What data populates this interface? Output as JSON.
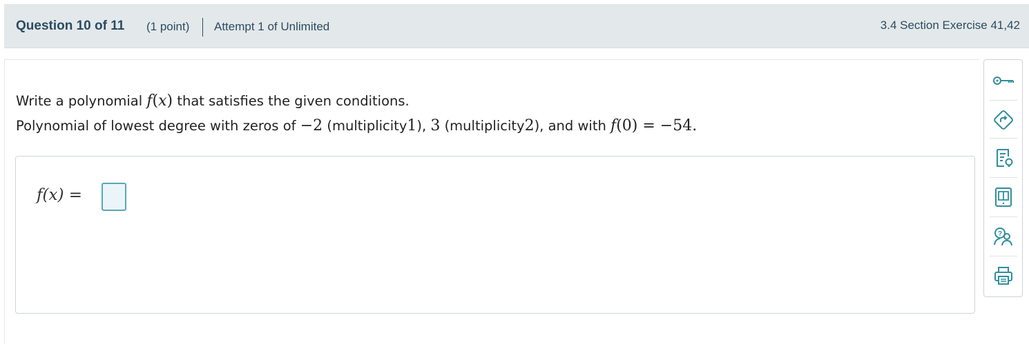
{
  "header": {
    "question": "Question 10 of 11",
    "points": "(1 point)",
    "attempt": "Attempt 1 of Unlimited",
    "section": "3.4 Section Exercise 41,42"
  },
  "problem": {
    "line1_prefix": "Write a polynomial",
    "line1_suffix": "that satisfies the given conditions.",
    "line2_prefix": "Polynomial of lowest degree with zeros of",
    "zero1": "−2",
    "mult_label_1": "(multiplicity",
    "mult1": "1",
    "zero2": "3",
    "mult_label_2": "(multiplicity",
    "mult2": "2",
    "and_with": "and with",
    "f0_value": "−54"
  },
  "answer": {
    "label": "f(x) =",
    "value": ""
  },
  "tools": [
    {
      "icon": "key-icon"
    },
    {
      "icon": "share-arrow-icon"
    },
    {
      "icon": "hint-document-icon"
    },
    {
      "icon": "ebook-icon"
    },
    {
      "icon": "help-people-icon"
    },
    {
      "icon": "print-icon"
    }
  ],
  "colors": {
    "header_bg": "#e3e8eb",
    "header_text": "#2b4b60",
    "accent_teal": "#2f8e9c",
    "input_border": "#59a7b6"
  }
}
